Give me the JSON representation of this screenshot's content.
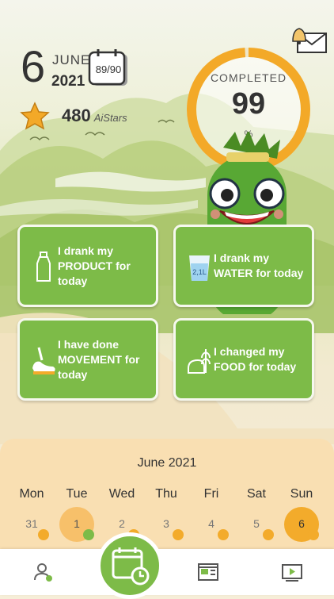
{
  "header": {
    "day": "6",
    "month": "JUNE",
    "year": "2021",
    "day_progress": "89/90",
    "stars": "480",
    "stars_unit": "AiStars"
  },
  "progress": {
    "label": "COMPLETED",
    "value": "99",
    "unit": "%",
    "fraction": 0.99,
    "color": "#f3a928"
  },
  "cards": [
    {
      "label": "I drank my PRODUCT for today",
      "icon": "bottle-icon"
    },
    {
      "label": "I drank my WATER for today",
      "icon": "water-glass-icon",
      "icon_text": "2,1L"
    },
    {
      "label": "I have done MOVEMENT for today",
      "icon": "running-shoe-icon"
    },
    {
      "label": "I changed my FOOD for today",
      "icon": "bread-wheat-icon"
    }
  ],
  "calendar": {
    "title": "June 2021",
    "weekdays": [
      "Mon",
      "Tue",
      "Wed",
      "Thu",
      "Fri",
      "Sat",
      "Sun"
    ],
    "days": [
      "31",
      "1",
      "2",
      "3",
      "4",
      "5",
      "6"
    ],
    "selected_day": "6"
  },
  "nav": {
    "items": [
      "profile-icon",
      "calendar-clock-icon",
      "news-icon",
      "video-icon"
    ]
  },
  "colors": {
    "accent_green": "#7dbb48",
    "accent_orange": "#f3ab2b",
    "calendar_bg": "#f9dfb2"
  }
}
